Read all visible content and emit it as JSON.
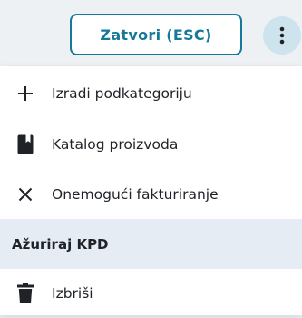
{
  "toolbar": {
    "close_label": "Zatvori (ESC)",
    "more_icon": "more-vertical-icon"
  },
  "menu": {
    "items": [
      {
        "label": "Izradi podkategoriju",
        "icon": "plus-icon"
      },
      {
        "label": "Katalog proizvoda",
        "icon": "book-icon"
      },
      {
        "label": "Onemogući fakturiranje",
        "icon": "close-icon"
      },
      {
        "label": "Ažuriraj KPD",
        "icon": ""
      },
      {
        "label": "Izbriši",
        "icon": "trash-icon"
      }
    ]
  },
  "colors": {
    "accent": "#16789a",
    "accent_soft": "#cde3ee",
    "highlight_row": "#e6ecf3"
  }
}
